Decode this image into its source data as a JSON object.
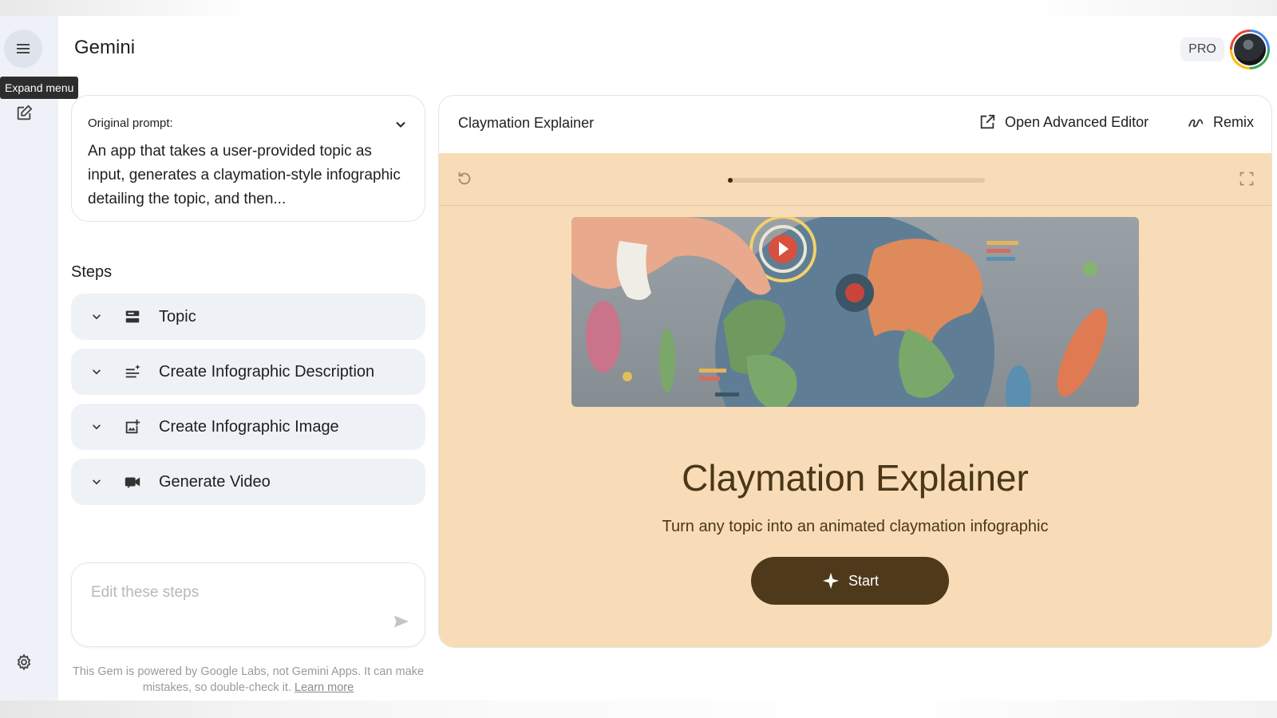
{
  "app": {
    "title": "Gemini",
    "badge": "PRO"
  },
  "rail": {
    "tooltip": "Expand menu"
  },
  "prompt": {
    "label": "Original prompt:",
    "text": "An app that takes a user-provided topic as input, generates a claymation-style infographic detailing the topic, and then..."
  },
  "steps": {
    "heading": "Steps",
    "items": [
      {
        "label": "Topic",
        "icon": "text-field-icon"
      },
      {
        "label": "Create Infographic Description",
        "icon": "text-sparkle-icon"
      },
      {
        "label": "Create Infographic Image",
        "icon": "add-image-icon"
      },
      {
        "label": "Generate Video",
        "icon": "video-icon"
      }
    ]
  },
  "edit": {
    "placeholder": "Edit these steps"
  },
  "disclaimer": {
    "text": "This Gem is powered by Google Labs, not Gemini Apps. It can make mistakes, so double-check it.",
    "link": "Learn more"
  },
  "panel": {
    "title": "Claymation Explainer",
    "advanced_editor": "Open Advanced Editor",
    "remix": "Remix",
    "progress": 0.0
  },
  "preview": {
    "title": "Claymation Explainer",
    "subtitle": "Turn any topic into an animated claymation infographic",
    "start": "Start"
  },
  "colors": {
    "rail_bg": "#eef1f8",
    "step_bg": "#eef1f6",
    "preview_bg": "#f8dcb7",
    "accent_brown": "#4e3a1a",
    "title_brown": "#4a3719"
  }
}
